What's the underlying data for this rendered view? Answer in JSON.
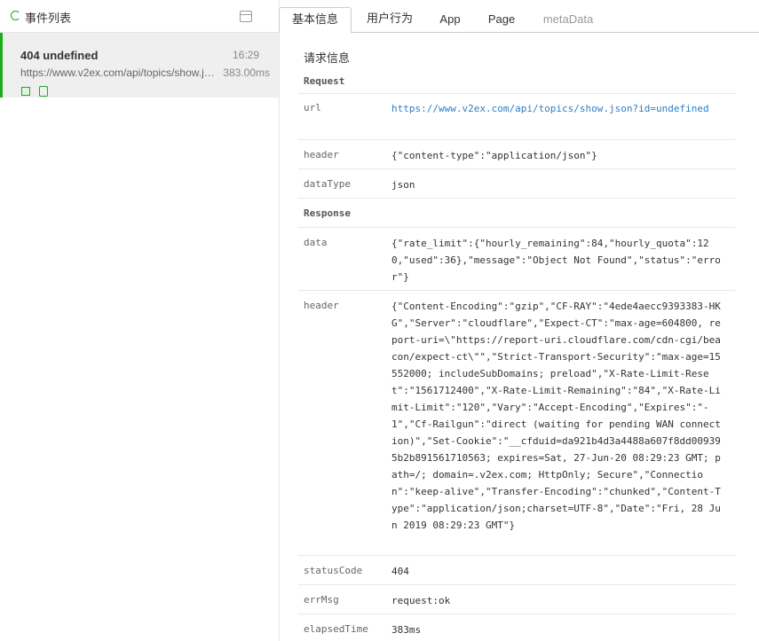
{
  "sidebar": {
    "title": "事件列表",
    "events": [
      {
        "name": "404 undefined",
        "time": "16:29",
        "url": "https://www.v2ex.com/api/topics/show.json?id=undefined",
        "duration": "383.00ms"
      }
    ]
  },
  "tabs": [
    {
      "label": "基本信息",
      "active": true
    },
    {
      "label": "用户行为",
      "active": false
    },
    {
      "label": "App",
      "active": false
    },
    {
      "label": "Page",
      "active": false
    },
    {
      "label": "metaData",
      "active": false,
      "disabled": true
    }
  ],
  "detail": {
    "section_title": "请求信息",
    "request_label": "Request",
    "response_label": "Response",
    "request": {
      "url_key": "url",
      "url": "https://www.v2ex.com/api/topics/show.json?id=undefined",
      "header_key": "header",
      "header": "{\"content-type\":\"application/json\"}",
      "dataType_key": "dataType",
      "dataType": "json"
    },
    "response": {
      "data_key": "data",
      "data": "{\"rate_limit\":{\"hourly_remaining\":84,\"hourly_quota\":120,\"used\":36},\"message\":\"Object Not Found\",\"status\":\"error\"}",
      "header_key": "header",
      "header": "{\"Content-Encoding\":\"gzip\",\"CF-RAY\":\"4ede4aecc9393383-HKG\",\"Server\":\"cloudflare\",\"Expect-CT\":\"max-age=604800, report-uri=\\\"https://report-uri.cloudflare.com/cdn-cgi/beacon/expect-ct\\\"\",\"Strict-Transport-Security\":\"max-age=15552000; includeSubDomains; preload\",\"X-Rate-Limit-Reset\":\"1561712400\",\"X-Rate-Limit-Remaining\":\"84\",\"X-Rate-Limit-Limit\":\"120\",\"Vary\":\"Accept-Encoding\",\"Expires\":\"-1\",\"Cf-Railgun\":\"direct (waiting for pending WAN connection)\",\"Set-Cookie\":\"__cfduid=da921b4d3a4488a607f8dd009395b2b891561710563; expires=Sat, 27-Jun-20 08:29:23 GMT; path=/; domain=.v2ex.com; HttpOnly; Secure\",\"Connection\":\"keep-alive\",\"Transfer-Encoding\":\"chunked\",\"Content-Type\":\"application/json;charset=UTF-8\",\"Date\":\"Fri, 28 Jun 2019 08:29:23 GMT\"}",
      "statusCode_key": "statusCode",
      "statusCode": "404",
      "errMsg_key": "errMsg",
      "errMsg": "request:ok",
      "elapsedTime_key": "elapsedTime",
      "elapsedTime": "383ms"
    }
  },
  "colors": {
    "accent": "#1aad19",
    "link": "#2d7ec4",
    "selected_bg": "#efefef"
  }
}
